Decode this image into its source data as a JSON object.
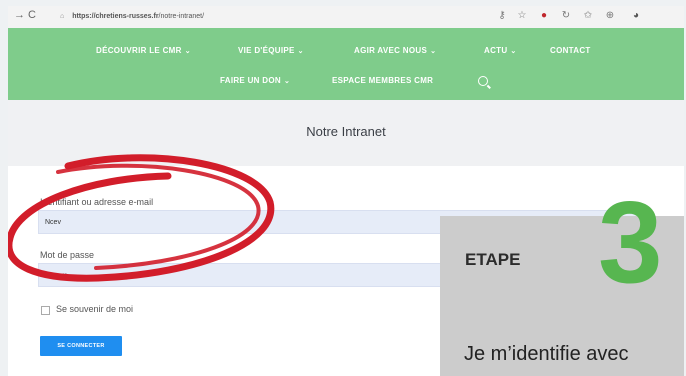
{
  "browser": {
    "url_host": "https://chretiens-russes.fr",
    "url_path": "/notre-intranet/"
  },
  "nav": {
    "row1": [
      {
        "label": "DÉCOUVRIR LE CMR",
        "dropdown": true
      },
      {
        "label": "VIE D'ÉQUIPE",
        "dropdown": true
      },
      {
        "label": "AGIR AVEC NOUS",
        "dropdown": true
      },
      {
        "label": "ACTU",
        "dropdown": true
      },
      {
        "label": "CONTACT",
        "dropdown": false
      }
    ],
    "row2": [
      {
        "label": "FAIRE UN DON",
        "dropdown": true
      },
      {
        "label": "ESPACE MEMBRES CMR",
        "dropdown": false
      }
    ],
    "chevron": "⌄"
  },
  "page": {
    "title": "Notre Intranet"
  },
  "login_form": {
    "username_label": "Identifiant ou adresse e-mail",
    "username_value": "Ncev",
    "password_label": "Mot de passe",
    "password_value": "•••••••••",
    "remember_label": "Se souvenir de moi",
    "submit_label": "SE CONNECTER"
  },
  "step": {
    "label": "ETAPE",
    "number": "3",
    "text": "Je m’identifie avec"
  },
  "colors": {
    "nav_green": "#7fcc8b",
    "step_green": "#57b650",
    "button_blue": "#1f8ef0",
    "annotation_red": "#d21d2a"
  }
}
